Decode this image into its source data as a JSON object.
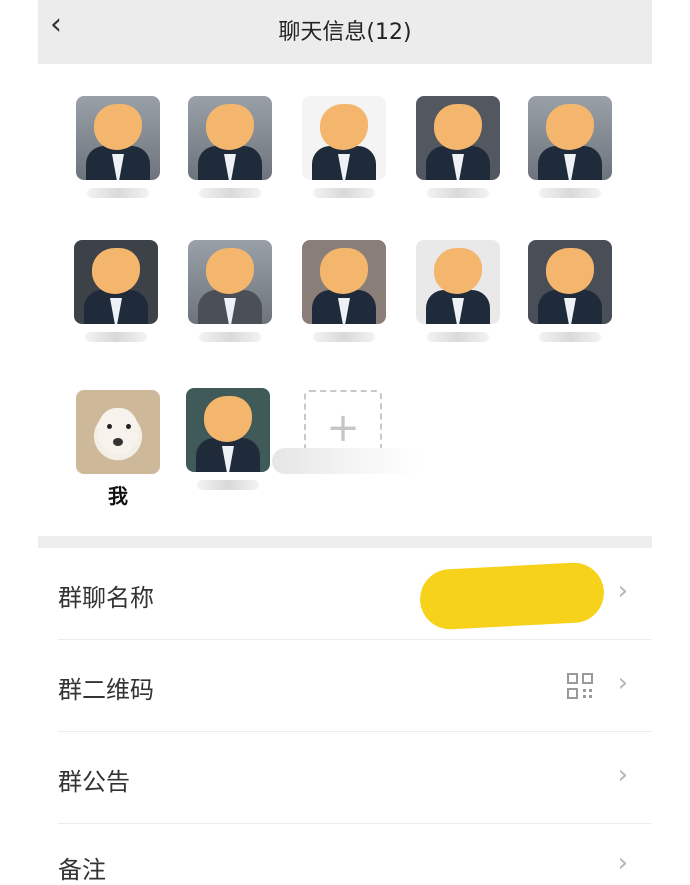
{
  "header": {
    "back_icon": "chevron-left-icon",
    "title": "聊天信息(12)"
  },
  "members": {
    "count": 12,
    "me_label": "我",
    "add_icon": "plus-icon"
  },
  "settings": [
    {
      "label": "群聊名称"
    },
    {
      "label": "群二维码",
      "icon": "qr-code-icon"
    },
    {
      "label": "群公告"
    },
    {
      "label": "备注"
    }
  ],
  "colors": {
    "header_bg": "#ececec",
    "redaction_yellow": "#f7d21b",
    "face_mask": "#f4b66d"
  }
}
